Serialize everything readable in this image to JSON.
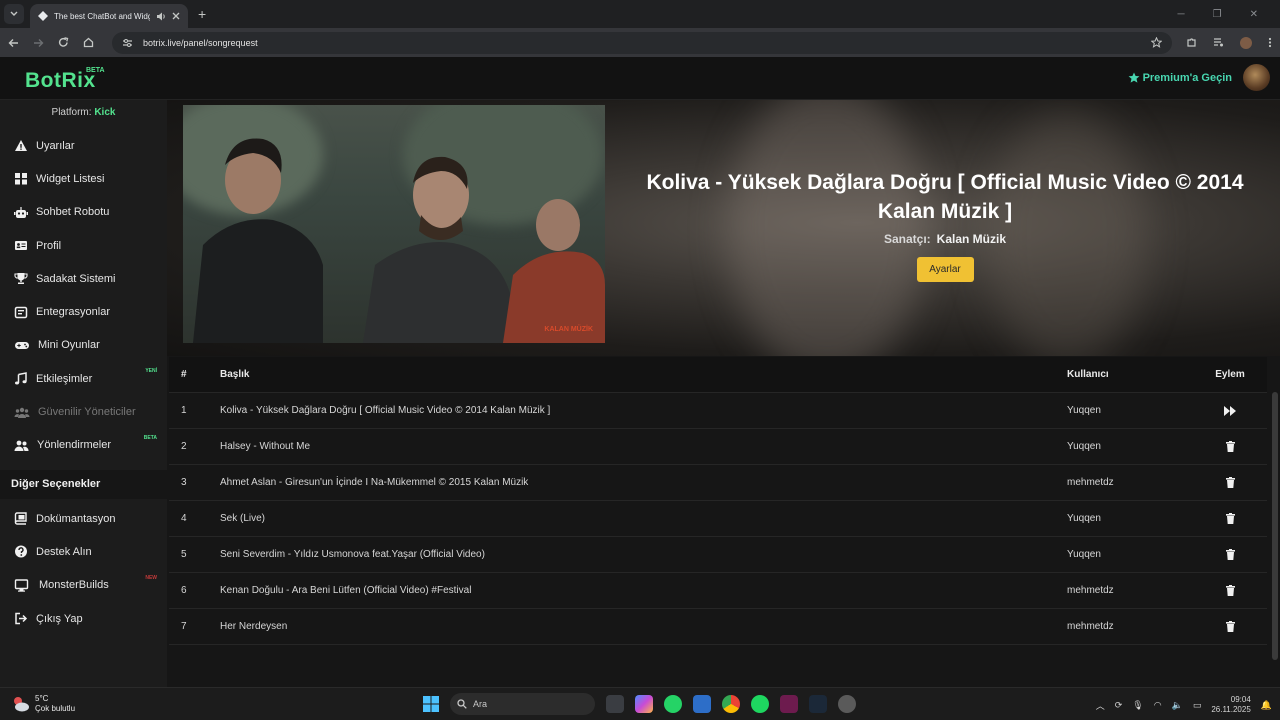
{
  "browser": {
    "tab_title": "The best ChatBot and Widg",
    "url": "botrix.live/panel/songrequest"
  },
  "header": {
    "logo": "BotRix",
    "beta": "BETA",
    "premium": "Premium'a Geçin"
  },
  "sidebar": {
    "platform_label": "Platform:",
    "platform_value": "Kick",
    "items": [
      {
        "label": "Uyarılar",
        "icon": "warning-icon"
      },
      {
        "label": "Widget Listesi",
        "icon": "grid-icon"
      },
      {
        "label": "Sohbet Robotu",
        "icon": "robot-icon"
      },
      {
        "label": "Profil",
        "icon": "id-card-icon"
      },
      {
        "label": "Sadakat Sistemi",
        "icon": "trophy-icon"
      },
      {
        "label": "Entegrasyonlar",
        "icon": "integration-icon"
      },
      {
        "label": "Mini Oyunlar",
        "icon": "gamepad-icon"
      },
      {
        "label": "Etkileşimler",
        "icon": "music-icon",
        "badge": "YENİ"
      },
      {
        "label": "Güvenilir Yöneticiler",
        "icon": "users-icon",
        "disabled": true
      },
      {
        "label": "Yönlendirmeler",
        "icon": "user-group-icon",
        "badge": "BETA"
      }
    ],
    "section_title": "Diğer Seçenekler",
    "other_items": [
      {
        "label": "Dokümantasyon",
        "icon": "book-icon"
      },
      {
        "label": "Destek Alın",
        "icon": "help-icon"
      },
      {
        "label": "MonsterBuilds",
        "icon": "monitor-icon",
        "badge": "NEW"
      },
      {
        "label": "Çıkış Yap",
        "icon": "logout-icon"
      }
    ]
  },
  "now_playing": {
    "title": "Koliva - Yüksek Dağlara Doğru [ Official Music Video © 2014 Kalan Müzik ]",
    "artist_label": "Sanatçı:",
    "artist": "Kalan Müzik",
    "settings_button": "Ayarlar",
    "video_watermark": "KALAN MÜZİK"
  },
  "table": {
    "headers": {
      "num": "#",
      "title": "Başlık",
      "user": "Kullanıcı",
      "action": "Eylem"
    },
    "rows": [
      {
        "num": "1",
        "title": "Koliva - Yüksek Dağlara Doğru [ Official Music Video © 2014 Kalan Müzik ]",
        "user": "Yuqqen",
        "action": "skip-icon"
      },
      {
        "num": "2",
        "title": "Halsey - Without Me",
        "user": "Yuqqen",
        "action": "trash-icon"
      },
      {
        "num": "3",
        "title": "Ahmet Aslan - Giresun'un İçinde I Na-Mükemmel © 2015 Kalan Müzik",
        "user": "mehmetdz",
        "action": "trash-icon"
      },
      {
        "num": "4",
        "title": "Sek (Live)",
        "user": "Yuqqen",
        "action": "trash-icon"
      },
      {
        "num": "5",
        "title": "Seni Severdim - Yıldız Usmonova feat.Yaşar (Official Video)",
        "user": "Yuqqen",
        "action": "trash-icon"
      },
      {
        "num": "6",
        "title": "Kenan Doğulu - Ara Beni Lütfen (Official Video) #Festival",
        "user": "mehmetdz",
        "action": "trash-icon"
      },
      {
        "num": "7",
        "title": "Her Nerdeysen",
        "user": "mehmetdz",
        "action": "trash-icon"
      }
    ]
  },
  "taskbar": {
    "temp": "5°C",
    "weather": "Çok bulutlu",
    "search": "Ara",
    "time": "09:04",
    "date": "26.11.2025"
  }
}
